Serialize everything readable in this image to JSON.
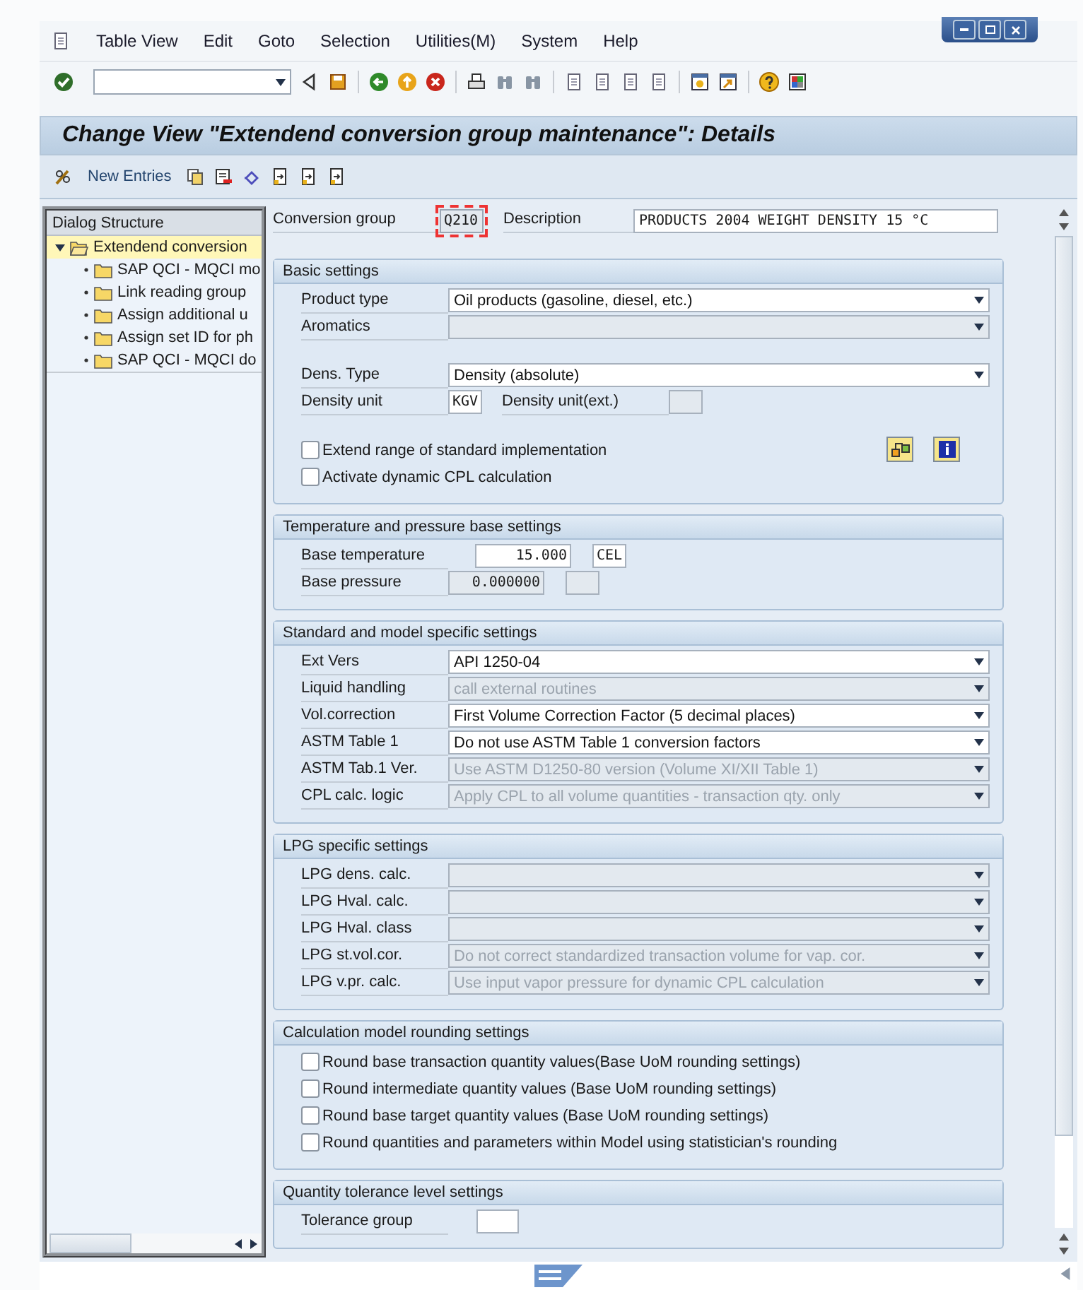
{
  "menu_bar": {
    "items": [
      {
        "label": "Table View"
      },
      {
        "label": "Edit"
      },
      {
        "label": "Goto"
      },
      {
        "label": "Selection"
      },
      {
        "label": "Utilities(M)"
      },
      {
        "label": "System"
      },
      {
        "label": "Help"
      }
    ]
  },
  "screen_title": "Change View \"Extendend conversion group maintenance\": Details",
  "app_toolbar": {
    "new_entries": "New Entries"
  },
  "dialog_structure": {
    "title": "Dialog Structure",
    "items": [
      {
        "label": "Extendend conversion",
        "selected": true,
        "expanded": true,
        "children": [
          {
            "label": "SAP QCI - MQCI mo",
            "selected": false
          },
          {
            "label": "Link reading group",
            "selected": false
          },
          {
            "label": "Assign additional u",
            "selected": false
          },
          {
            "label": "Assign set ID for ph",
            "selected": false
          },
          {
            "label": "SAP QCI - MQCI do",
            "selected": false
          }
        ]
      }
    ]
  },
  "header": {
    "conversion_group": {
      "label": "Conversion group",
      "value": "Q210"
    },
    "description": {
      "label": "Description",
      "value": "PRODUCTS 2004 WEIGHT DENSITY 15 °C"
    }
  },
  "sections": [
    {
      "title": "Basic settings",
      "groups": [
        {
          "rows": [
            {
              "kind": "dropdown",
              "label": "Product type",
              "value": "Oil products (gasoline, diesel, etc.)",
              "disabled": false
            },
            {
              "kind": "dropdown",
              "label": "Aromatics",
              "disabled": true
            }
          ]
        },
        {
          "rows": [
            {
              "kind": "dropdown",
              "label": "Dens. Type",
              "value": "Density (absolute)",
              "disabled": false
            },
            {
              "kind": "unit_pair",
              "label": "Density unit",
              "value": "KGV",
              "ext_label": "Density unit(ext.)"
            }
          ]
        },
        {
          "tools": true,
          "rows": [
            {
              "kind": "checkbox",
              "label": "Extend range of standard implementation",
              "checked": false
            },
            {
              "kind": "checkbox",
              "label": "Activate dynamic CPL calculation",
              "checked": false
            }
          ]
        }
      ]
    },
    {
      "title": "Temperature and pressure base settings",
      "groups": [
        {
          "rows": [
            {
              "kind": "quantity",
              "label": "Base temperature",
              "value": "15.000",
              "unit": "CEL",
              "disabled": false
            },
            {
              "kind": "quantity",
              "label": "Base pressure",
              "value": "0.000000",
              "disabled": true
            }
          ]
        }
      ]
    },
    {
      "title": "Standard and model specific settings",
      "groups": [
        {
          "rows": [
            {
              "kind": "dropdown",
              "label": "Ext Vers",
              "value": "API 1250-04",
              "disabled": false
            },
            {
              "kind": "dropdown",
              "label": "Liquid handling",
              "value": "call external routines",
              "disabled": true
            },
            {
              "kind": "dropdown",
              "label": "Vol.correction",
              "value": "First Volume Correction Factor (5 decimal places)",
              "disabled": false
            },
            {
              "kind": "dropdown",
              "label": "ASTM Table 1",
              "value": "Do not use ASTM Table 1 conversion factors",
              "disabled": false
            },
            {
              "kind": "dropdown",
              "label": "ASTM Tab.1 Ver.",
              "value": "Use ASTM D1250-80 version (Volume XI/XII Table 1)",
              "disabled": true
            },
            {
              "kind": "dropdown",
              "label": "CPL calc. logic",
              "value": "Apply CPL to all volume quantities - transaction qty. only",
              "disabled": true
            }
          ]
        }
      ]
    },
    {
      "title": "LPG specific settings",
      "groups": [
        {
          "rows": [
            {
              "kind": "dropdown",
              "label": "LPG dens. calc.",
              "disabled": true
            },
            {
              "kind": "dropdown",
              "label": "LPG Hval. calc.",
              "disabled": true
            },
            {
              "kind": "dropdown",
              "label": "LPG Hval. class",
              "disabled": true
            },
            {
              "kind": "dropdown",
              "label": "LPG st.vol.cor.",
              "value": "Do not correct standardized transaction volume for vap. cor.",
              "disabled": true
            },
            {
              "kind": "dropdown",
              "label": "LPG v.pr. calc.",
              "value": "Use input vapor pressure for dynamic CPL calculation",
              "disabled": true
            }
          ]
        }
      ]
    },
    {
      "title": "Calculation model rounding settings",
      "groups": [
        {
          "rows": [
            {
              "kind": "checkbox",
              "label": "Round base transaction quantity values(Base UoM rounding settings)",
              "checked": false
            },
            {
              "kind": "checkbox",
              "label": "Round intermediate quantity values (Base UoM rounding settings)",
              "checked": false
            },
            {
              "kind": "checkbox",
              "label": "Round base target quantity values (Base UoM rounding settings)",
              "checked": false
            },
            {
              "kind": "checkbox",
              "label": "Round quantities and parameters within Model using statistician's rounding",
              "checked": false
            }
          ]
        }
      ]
    },
    {
      "title": "Quantity tolerance level settings",
      "groups": [
        {
          "rows": [
            {
              "kind": "input",
              "label": "Tolerance group"
            }
          ]
        }
      ]
    }
  ]
}
